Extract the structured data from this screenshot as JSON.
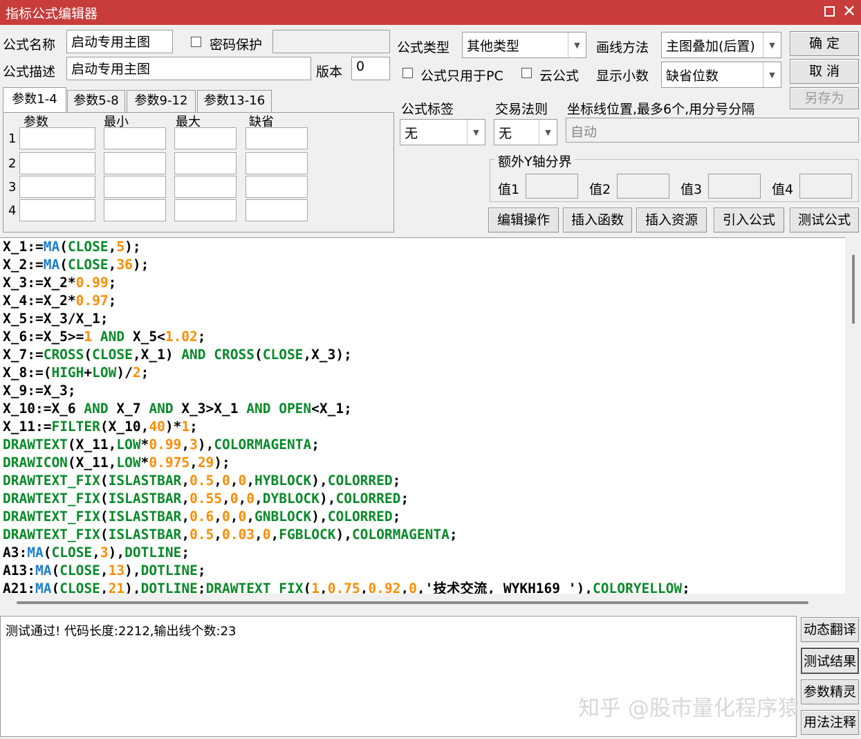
{
  "window": {
    "title": "指标公式编辑器"
  },
  "form": {
    "name_label": "公式名称",
    "name_value": "启动专用主图",
    "password_label": "密码保护",
    "desc_label": "公式描述",
    "desc_value": "启动专用主图",
    "version_label": "版本",
    "version_value": "0",
    "type_label": "公式类型",
    "type_value": "其他类型",
    "draw_label": "画线方法",
    "draw_value": "主图叠加(后置)",
    "pc_only_label": "公式只用于PC",
    "cloud_label": "云公式",
    "decimal_label": "显示小数",
    "decimal_value": "缺省位数",
    "tag_label": "公式标签",
    "tag_value": "无",
    "rule_label": "交易法则",
    "rule_value": "无",
    "axis_label": "坐标线位置,最多6个,用分号分隔",
    "axis_value": "自动",
    "yaxis_group": "额外Y轴分界",
    "val1": "值1",
    "val2": "值2",
    "val3": "值3",
    "val4": "值4"
  },
  "buttons": {
    "ok": "确  定",
    "cancel": "取  消",
    "save_as": "另存为",
    "edit_ops": "编辑操作",
    "insert_func": "插入函数",
    "insert_res": "插入资源",
    "import": "引入公式",
    "test": "测试公式",
    "dyn_translate": "动态翻译",
    "test_result": "测试结果",
    "param_wizard": "参数精灵",
    "usage_note": "用法注释"
  },
  "param_tabs": [
    "参数1-4",
    "参数5-8",
    "参数9-12",
    "参数13-16"
  ],
  "param_headers": [
    "参数",
    "最小",
    "最大",
    "缺省"
  ],
  "param_rows": [
    "1",
    "2",
    "3",
    "4"
  ],
  "code_lines": [
    [
      [
        "k",
        "X_1:="
      ],
      [
        "m",
        "MA"
      ],
      [
        "k",
        "("
      ],
      [
        "f",
        "CLOSE"
      ],
      [
        "k",
        ","
      ],
      [
        "n",
        "5"
      ],
      [
        "k",
        ");"
      ]
    ],
    [
      [
        "k",
        "X_2:="
      ],
      [
        "m",
        "MA"
      ],
      [
        "k",
        "("
      ],
      [
        "f",
        "CLOSE"
      ],
      [
        "k",
        ","
      ],
      [
        "n",
        "36"
      ],
      [
        "k",
        ");"
      ]
    ],
    [
      [
        "k",
        "X_3:=X_2*"
      ],
      [
        "n",
        "0.99"
      ],
      [
        "k",
        ";"
      ]
    ],
    [
      [
        "k",
        "X_4:=X_2*"
      ],
      [
        "n",
        "0.97"
      ],
      [
        "k",
        ";"
      ]
    ],
    [
      [
        "k",
        "X_5:=X_3/X_1;"
      ]
    ],
    [
      [
        "k",
        "X_6:=X_5>="
      ],
      [
        "n",
        "1"
      ],
      [
        "f",
        " AND "
      ],
      [
        "k",
        "X_5<"
      ],
      [
        "n",
        "1.02"
      ],
      [
        "k",
        ";"
      ]
    ],
    [
      [
        "k",
        "X_7:="
      ],
      [
        "f",
        "CROSS"
      ],
      [
        "k",
        "("
      ],
      [
        "f",
        "CLOSE"
      ],
      [
        "k",
        ",X_1)"
      ],
      [
        "f",
        " AND "
      ],
      [
        "f",
        "CROSS"
      ],
      [
        "k",
        "("
      ],
      [
        "f",
        "CLOSE"
      ],
      [
        "k",
        ",X_3);"
      ]
    ],
    [
      [
        "k",
        "X_8:=("
      ],
      [
        "f",
        "HIGH"
      ],
      [
        "k",
        "+"
      ],
      [
        "f",
        "LOW"
      ],
      [
        "k",
        ")/"
      ],
      [
        "n",
        "2"
      ],
      [
        "k",
        ";"
      ]
    ],
    [
      [
        "k",
        "X_9:=X_3;"
      ]
    ],
    [
      [
        "k",
        "X_10:=X_6"
      ],
      [
        "f",
        " AND "
      ],
      [
        "k",
        "X_7"
      ],
      [
        "f",
        " AND "
      ],
      [
        "k",
        "X_3>X_1"
      ],
      [
        "f",
        " AND "
      ],
      [
        "f",
        "OPEN"
      ],
      [
        "k",
        "<X_1;"
      ]
    ],
    [
      [
        "k",
        "X_11:="
      ],
      [
        "f",
        "FILTER"
      ],
      [
        "k",
        "(X_10,"
      ],
      [
        "n",
        "40"
      ],
      [
        "k",
        ")*"
      ],
      [
        "n",
        "1"
      ],
      [
        "k",
        ";"
      ]
    ],
    [
      [
        "f",
        "DRAWTEXT"
      ],
      [
        "k",
        "(X_11,"
      ],
      [
        "f",
        "LOW"
      ],
      [
        "k",
        "*"
      ],
      [
        "n",
        "0.99"
      ],
      [
        "k",
        ","
      ],
      [
        "n",
        "3"
      ],
      [
        "k",
        "),"
      ],
      [
        "f",
        "COLORMAGENTA"
      ],
      [
        "k",
        ";"
      ]
    ],
    [
      [
        "f",
        "DRAWICON"
      ],
      [
        "k",
        "(X_11,"
      ],
      [
        "f",
        "LOW"
      ],
      [
        "k",
        "*"
      ],
      [
        "n",
        "0.975"
      ],
      [
        "k",
        ","
      ],
      [
        "n",
        "29"
      ],
      [
        "k",
        ");"
      ]
    ],
    [
      [
        "f",
        "DRAWTEXT_FIX"
      ],
      [
        "k",
        "("
      ],
      [
        "f",
        "ISLASTBAR"
      ],
      [
        "k",
        ","
      ],
      [
        "n",
        "0.5"
      ],
      [
        "k",
        ","
      ],
      [
        "n",
        "0"
      ],
      [
        "k",
        ","
      ],
      [
        "n",
        "0"
      ],
      [
        "k",
        ","
      ],
      [
        "f",
        "HYBLOCK"
      ],
      [
        "k",
        "),"
      ],
      [
        "f",
        "COLORRED"
      ],
      [
        "k",
        ";"
      ]
    ],
    [
      [
        "f",
        "DRAWTEXT_FIX"
      ],
      [
        "k",
        "("
      ],
      [
        "f",
        "ISLASTBAR"
      ],
      [
        "k",
        ","
      ],
      [
        "n",
        "0.55"
      ],
      [
        "k",
        ","
      ],
      [
        "n",
        "0"
      ],
      [
        "k",
        ","
      ],
      [
        "n",
        "0"
      ],
      [
        "k",
        ","
      ],
      [
        "f",
        "DYBLOCK"
      ],
      [
        "k",
        "),"
      ],
      [
        "f",
        "COLORRED"
      ],
      [
        "k",
        ";"
      ]
    ],
    [
      [
        "f",
        "DRAWTEXT_FIX"
      ],
      [
        "k",
        "("
      ],
      [
        "f",
        "ISLASTBAR"
      ],
      [
        "k",
        ","
      ],
      [
        "n",
        "0.6"
      ],
      [
        "k",
        ","
      ],
      [
        "n",
        "0"
      ],
      [
        "k",
        ","
      ],
      [
        "n",
        "0"
      ],
      [
        "k",
        ","
      ],
      [
        "f",
        "GNBLOCK"
      ],
      [
        "k",
        "),"
      ],
      [
        "f",
        "COLORRED"
      ],
      [
        "k",
        ";"
      ]
    ],
    [
      [
        "f",
        "DRAWTEXT_FIX"
      ],
      [
        "k",
        "("
      ],
      [
        "f",
        "ISLASTBAR"
      ],
      [
        "k",
        ","
      ],
      [
        "n",
        "0.5"
      ],
      [
        "k",
        ","
      ],
      [
        "n",
        "0.03"
      ],
      [
        "k",
        ","
      ],
      [
        "n",
        "0"
      ],
      [
        "k",
        ","
      ],
      [
        "f",
        "FGBLOCK"
      ],
      [
        "k",
        "),"
      ],
      [
        "f",
        "COLORMAGENTA"
      ],
      [
        "k",
        ";"
      ]
    ],
    [
      [
        "k",
        "A3:"
      ],
      [
        "m",
        "MA"
      ],
      [
        "k",
        "("
      ],
      [
        "f",
        "CLOSE"
      ],
      [
        "k",
        ","
      ],
      [
        "n",
        "3"
      ],
      [
        "k",
        "),"
      ],
      [
        "f",
        "DOTLINE"
      ],
      [
        "k",
        ";"
      ]
    ],
    [
      [
        "k",
        "A13:"
      ],
      [
        "m",
        "MA"
      ],
      [
        "k",
        "("
      ],
      [
        "f",
        "CLOSE"
      ],
      [
        "k",
        ","
      ],
      [
        "n",
        "13"
      ],
      [
        "k",
        "),"
      ],
      [
        "f",
        "DOTLINE"
      ],
      [
        "k",
        ";"
      ]
    ],
    [
      [
        "k",
        "A21:"
      ],
      [
        "m",
        "MA"
      ],
      [
        "k",
        "("
      ],
      [
        "f",
        "CLOSE"
      ],
      [
        "k",
        ","
      ],
      [
        "n",
        "21"
      ],
      [
        "k",
        "),"
      ],
      [
        "f",
        "DOTLINE"
      ],
      [
        "k",
        ";"
      ],
      [
        "f",
        "DRAWTEXT_FIX"
      ],
      [
        "k",
        "("
      ],
      [
        "n",
        "1"
      ],
      [
        "k",
        ","
      ],
      [
        "n",
        "0.75"
      ],
      [
        "k",
        ","
      ],
      [
        "n",
        "0.92"
      ],
      [
        "k",
        ","
      ],
      [
        "n",
        "0"
      ],
      [
        "k",
        ",'技术交流, WYKH169 '),"
      ],
      [
        "f",
        "COLORYELLOW"
      ],
      [
        "k",
        ";"
      ]
    ]
  ],
  "status": {
    "message": "测试通过! 代码长度:2212,输出线个数:23"
  },
  "watermark": "知乎 @股市量化程序猿",
  "colors": {
    "titlebar": "#c83c3c",
    "func": "#0a8a2a",
    "number": "#ff8c00",
    "ma": "#1e7fd0"
  }
}
